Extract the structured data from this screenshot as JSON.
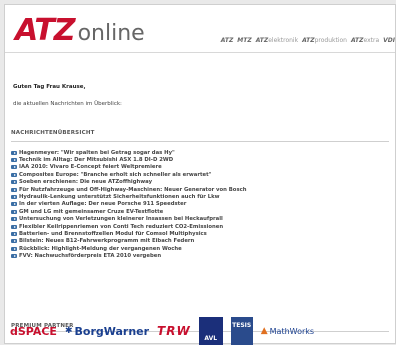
{
  "header": {
    "logo_main": "ATZ",
    "logo_sub": "online",
    "brands": [
      {
        "main": "ATZ",
        "sub": ""
      },
      {
        "main": "MTZ",
        "sub": ""
      },
      {
        "main": "ATZ",
        "sub": "elektronik"
      },
      {
        "main": "ATZ",
        "sub": "produktion"
      },
      {
        "main": "ATZ",
        "sub": "extra"
      },
      {
        "main": "VDI",
        "sub": ""
      }
    ]
  },
  "greeting": "Guten Tag Frau Krause,",
  "intro": "die aktuellen Nachrichten im Überblick:",
  "news_section": {
    "title": "NACHRICHTENÜBERSICHT",
    "items": [
      "Hagenmeyer: \"Wir spalten bei Getrag sogar das Hy\"",
      "Technik im Alltag: Der Mitsubishi ASX 1.8 DI-D 2WD",
      "IAA 2010: Vivaro E-Concept feiert Weltpremiere",
      "Composites Europe: \"Branche erholt sich schneller als erwartet\"",
      "Soeben erschienen: Die neue ATZoffhighway",
      "Für Nutzfahrzeuge und Off-Highway-Maschinen: Neuer Generator von Bosch",
      "Hydraulik-Lenkung unterstützt Sicherheitsfunktionen auch für Lkw",
      "In der vierten Auflage: Der neue Porsche 911 Speedster",
      "GM und LG mit gemeinsamer Cruze EV-Testflotte",
      "Untersuchung von Verletzungen kleinerer Insassen bei Heckaufprall",
      "Flexibler Keilrippenriemen von Conti Tech reduziert CO2-Emissionen",
      "Batterien- und Brennstoffzellen Modul für Comsol Multiphysics",
      "Bilstein: Neues B12-Fahrwerkprogramm mit Eibach Federn",
      "Rückblick: Highlight-Meldung der vergangenen Woche",
      "FVV: Nachwuchsförderpreis ETA 2010 vergeben"
    ]
  },
  "partner_section": {
    "title": "PREMIUM PARTNER",
    "partners": [
      "dSPACE",
      "BorgWarner",
      "TRW",
      "AVL",
      "TESIS",
      "MathWorks"
    ]
  },
  "colors": {
    "brand_red": "#c8102e",
    "link_blue": "#3a6ea5",
    "partner_blue": "#1a3f8f"
  }
}
